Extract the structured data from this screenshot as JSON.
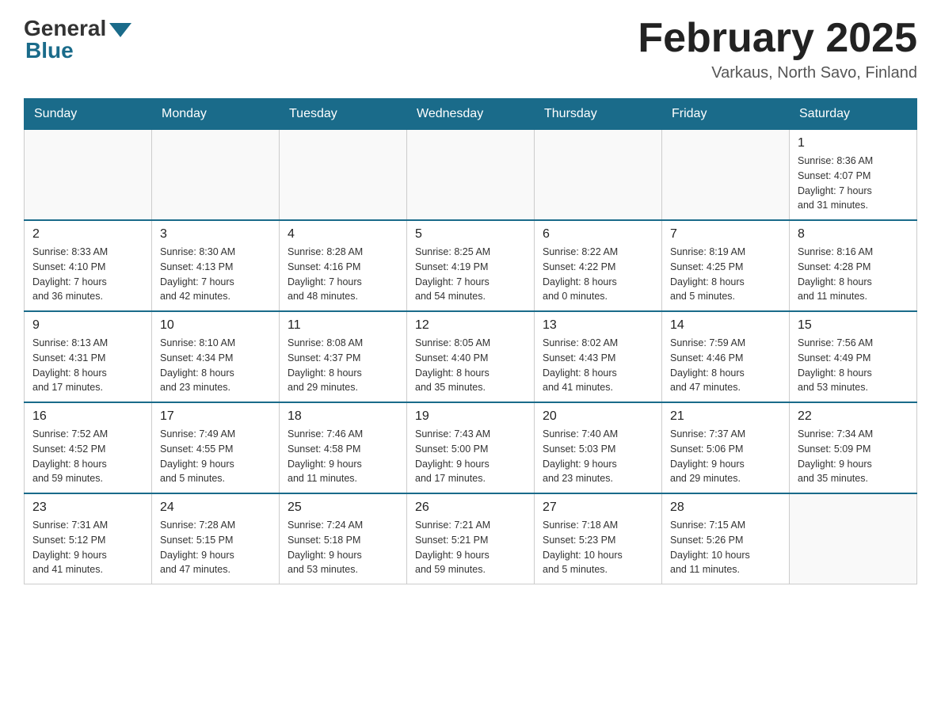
{
  "header": {
    "logo_general": "General",
    "logo_blue": "Blue",
    "month_title": "February 2025",
    "location": "Varkaus, North Savo, Finland"
  },
  "days_of_week": [
    "Sunday",
    "Monday",
    "Tuesday",
    "Wednesday",
    "Thursday",
    "Friday",
    "Saturday"
  ],
  "weeks": [
    [
      {
        "day": "",
        "info": ""
      },
      {
        "day": "",
        "info": ""
      },
      {
        "day": "",
        "info": ""
      },
      {
        "day": "",
        "info": ""
      },
      {
        "day": "",
        "info": ""
      },
      {
        "day": "",
        "info": ""
      },
      {
        "day": "1",
        "info": "Sunrise: 8:36 AM\nSunset: 4:07 PM\nDaylight: 7 hours\nand 31 minutes."
      }
    ],
    [
      {
        "day": "2",
        "info": "Sunrise: 8:33 AM\nSunset: 4:10 PM\nDaylight: 7 hours\nand 36 minutes."
      },
      {
        "day": "3",
        "info": "Sunrise: 8:30 AM\nSunset: 4:13 PM\nDaylight: 7 hours\nand 42 minutes."
      },
      {
        "day": "4",
        "info": "Sunrise: 8:28 AM\nSunset: 4:16 PM\nDaylight: 7 hours\nand 48 minutes."
      },
      {
        "day": "5",
        "info": "Sunrise: 8:25 AM\nSunset: 4:19 PM\nDaylight: 7 hours\nand 54 minutes."
      },
      {
        "day": "6",
        "info": "Sunrise: 8:22 AM\nSunset: 4:22 PM\nDaylight: 8 hours\nand 0 minutes."
      },
      {
        "day": "7",
        "info": "Sunrise: 8:19 AM\nSunset: 4:25 PM\nDaylight: 8 hours\nand 5 minutes."
      },
      {
        "day": "8",
        "info": "Sunrise: 8:16 AM\nSunset: 4:28 PM\nDaylight: 8 hours\nand 11 minutes."
      }
    ],
    [
      {
        "day": "9",
        "info": "Sunrise: 8:13 AM\nSunset: 4:31 PM\nDaylight: 8 hours\nand 17 minutes."
      },
      {
        "day": "10",
        "info": "Sunrise: 8:10 AM\nSunset: 4:34 PM\nDaylight: 8 hours\nand 23 minutes."
      },
      {
        "day": "11",
        "info": "Sunrise: 8:08 AM\nSunset: 4:37 PM\nDaylight: 8 hours\nand 29 minutes."
      },
      {
        "day": "12",
        "info": "Sunrise: 8:05 AM\nSunset: 4:40 PM\nDaylight: 8 hours\nand 35 minutes."
      },
      {
        "day": "13",
        "info": "Sunrise: 8:02 AM\nSunset: 4:43 PM\nDaylight: 8 hours\nand 41 minutes."
      },
      {
        "day": "14",
        "info": "Sunrise: 7:59 AM\nSunset: 4:46 PM\nDaylight: 8 hours\nand 47 minutes."
      },
      {
        "day": "15",
        "info": "Sunrise: 7:56 AM\nSunset: 4:49 PM\nDaylight: 8 hours\nand 53 minutes."
      }
    ],
    [
      {
        "day": "16",
        "info": "Sunrise: 7:52 AM\nSunset: 4:52 PM\nDaylight: 8 hours\nand 59 minutes."
      },
      {
        "day": "17",
        "info": "Sunrise: 7:49 AM\nSunset: 4:55 PM\nDaylight: 9 hours\nand 5 minutes."
      },
      {
        "day": "18",
        "info": "Sunrise: 7:46 AM\nSunset: 4:58 PM\nDaylight: 9 hours\nand 11 minutes."
      },
      {
        "day": "19",
        "info": "Sunrise: 7:43 AM\nSunset: 5:00 PM\nDaylight: 9 hours\nand 17 minutes."
      },
      {
        "day": "20",
        "info": "Sunrise: 7:40 AM\nSunset: 5:03 PM\nDaylight: 9 hours\nand 23 minutes."
      },
      {
        "day": "21",
        "info": "Sunrise: 7:37 AM\nSunset: 5:06 PM\nDaylight: 9 hours\nand 29 minutes."
      },
      {
        "day": "22",
        "info": "Sunrise: 7:34 AM\nSunset: 5:09 PM\nDaylight: 9 hours\nand 35 minutes."
      }
    ],
    [
      {
        "day": "23",
        "info": "Sunrise: 7:31 AM\nSunset: 5:12 PM\nDaylight: 9 hours\nand 41 minutes."
      },
      {
        "day": "24",
        "info": "Sunrise: 7:28 AM\nSunset: 5:15 PM\nDaylight: 9 hours\nand 47 minutes."
      },
      {
        "day": "25",
        "info": "Sunrise: 7:24 AM\nSunset: 5:18 PM\nDaylight: 9 hours\nand 53 minutes."
      },
      {
        "day": "26",
        "info": "Sunrise: 7:21 AM\nSunset: 5:21 PM\nDaylight: 9 hours\nand 59 minutes."
      },
      {
        "day": "27",
        "info": "Sunrise: 7:18 AM\nSunset: 5:23 PM\nDaylight: 10 hours\nand 5 minutes."
      },
      {
        "day": "28",
        "info": "Sunrise: 7:15 AM\nSunset: 5:26 PM\nDaylight: 10 hours\nand 11 minutes."
      },
      {
        "day": "",
        "info": ""
      }
    ]
  ]
}
